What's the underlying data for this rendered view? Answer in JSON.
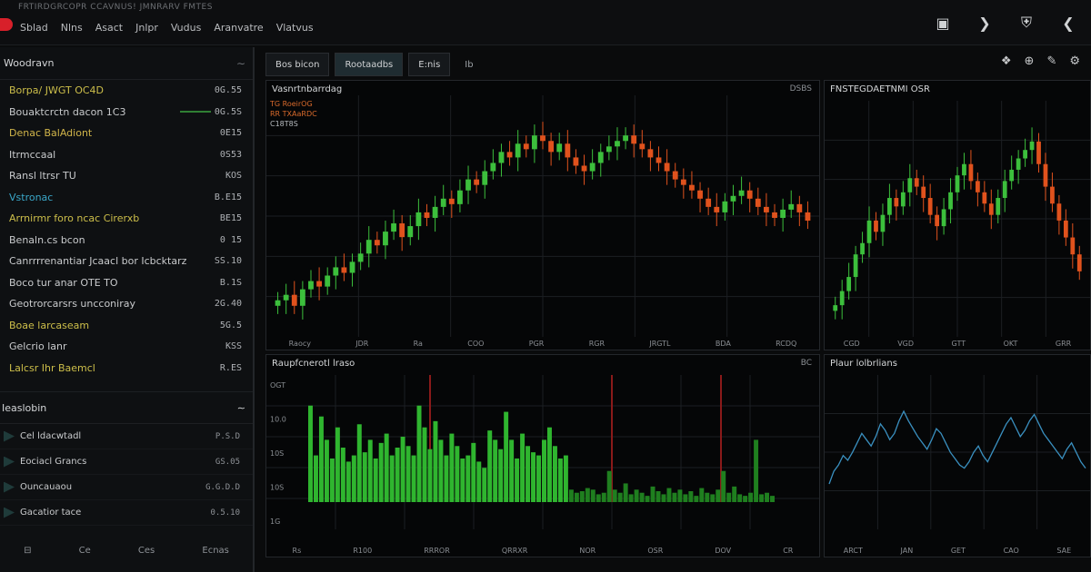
{
  "app": {
    "subtitle": "FRTIRDGRCOPR CCAVNUS! JMNRARV FMTES",
    "nav": [
      "Sblad",
      "Nlns",
      "Asact",
      "Jnlpr",
      "Vudus",
      "Aranvatre",
      "Vlatvus"
    ]
  },
  "top_icons": [
    "bag-icon",
    "bell-icon",
    "cart-icon",
    "share-icon"
  ],
  "sidebar": {
    "watchlist_title": "Woodravn",
    "watchlist": [
      {
        "label": "Borpa/ JWGT OC4D",
        "value": "0G.55",
        "color": "#cdbf4a"
      },
      {
        "label": "Bouaktcrctn dacon 1C3",
        "value": "0G.5S",
        "color": "#c9cbcd"
      },
      {
        "label": "Denac BalAdiont",
        "value": "0E15",
        "color": "#d1b54a"
      },
      {
        "label": "Itrmccaal",
        "value": "0S53",
        "color": "#c9cbcd"
      },
      {
        "label": "Ransl ltrsr TU",
        "value": "KOS",
        "color": "#c9cbcd"
      },
      {
        "label": "Vstronac",
        "value": "B.E15",
        "color": "#3aa7c8"
      },
      {
        "label": "Arrnirmr foro ncac Cirerxb",
        "value": "BE15",
        "color": "#cdbf4a"
      },
      {
        "label": "Benaln.cs bcon",
        "value": "0 15",
        "color": "#c9cbcd"
      },
      {
        "label": "Canrrrrenantiar Jcaacl bor Icbcktarz",
        "value": "SS.10",
        "color": "#c9cbcd"
      },
      {
        "label": "Boco tur anar OTE TO",
        "value": "B.1S",
        "color": "#c9cbcd"
      },
      {
        "label": "Geotrorcarsrs uncconiray",
        "value": "2G.40",
        "color": "#c9cbcd"
      },
      {
        "label": "Boae larcaseam",
        "value": "5G.5",
        "color": "#cdbf4a"
      },
      {
        "label": "Gelcrio lanr",
        "value": "KSS",
        "color": "#c9cbcd"
      },
      {
        "label": "Lalcsr Ihr Baemcl",
        "value": "R.ES",
        "color": "#cdbf4a"
      }
    ],
    "movers_title": "Ieaslobin",
    "movers": [
      {
        "label": "Cel ldacwtadl",
        "value": "P.S.D"
      },
      {
        "label": "Eociacl Grancs",
        "value": "GS.05"
      },
      {
        "label": "Ouncauaou",
        "value": "G.G.D.D"
      },
      {
        "label": "Gacatior tace",
        "value": "0.5.10"
      }
    ],
    "footer": [
      "⊟",
      "Ce",
      "Ces",
      "Ecnas"
    ]
  },
  "tabs": [
    {
      "label": "Bos bicon",
      "active": false
    },
    {
      "label": "Rootaadbs",
      "active": true
    },
    {
      "label": "E:nis",
      "active": false
    }
  ],
  "tab_extra": "Ib",
  "toolbar_icons": [
    "crosshair-icon",
    "zoom-icon",
    "drawing-icon",
    "settings-icon"
  ],
  "panels": {
    "main": {
      "title": "Vasnrtnbarrdag",
      "stats": [
        "TG RoeirOG",
        "RR TXAaRDC",
        "C18T8S"
      ],
      "ctl": "DSBS",
      "x_labels": [
        "Raocy",
        "JDR",
        "Ra",
        "COO",
        "PGR",
        "RGR",
        "JRGTL",
        "BDA",
        "RCDQ"
      ]
    },
    "side": {
      "title": "FNSTEGDAETNMI OSR",
      "x_labels": [
        "CGD",
        "VGD",
        "GTT",
        "OKT",
        "GRR"
      ]
    },
    "volume": {
      "title": "Raupfcnerotl lraso",
      "ctl": "BC",
      "y_labels": [
        "OGT",
        "10.0",
        "10S",
        "10S",
        "1G"
      ],
      "x_labels": [
        "Rs",
        "R100",
        "RRROR",
        "QRRXR",
        "NOR",
        "OSR",
        "DOV",
        "CR"
      ]
    },
    "line": {
      "title": "Plaur lolbrlians",
      "x_labels": [
        "ARCT",
        "JAN",
        "GET",
        "CAO",
        "SAE"
      ]
    }
  },
  "chart_data": [
    {
      "type": "candlestick",
      "title": "Vasnrtnbarrdag",
      "series": [
        {
          "close": [
            38,
            40,
            36,
            42,
            45,
            43,
            47,
            50,
            48,
            52,
            55,
            60,
            58,
            63,
            66,
            61,
            65,
            70,
            68,
            72,
            75,
            73,
            78,
            82,
            80,
            85,
            88,
            92,
            90,
            95,
            93,
            98,
            96,
            92,
            95,
            90,
            87,
            85,
            88,
            92,
            94,
            96,
            98,
            95,
            93,
            90,
            88,
            85,
            82,
            80,
            78,
            75,
            72,
            70,
            74,
            76,
            78,
            75,
            72,
            70,
            68,
            71,
            73,
            70,
            67
          ],
          "up_color": "#3cbf3c",
          "down_color": "#e0521d"
        }
      ]
    },
    {
      "type": "candlestick",
      "title": "FNSTEGDAETNMI OSR",
      "series": [
        {
          "close": [
            40,
            45,
            50,
            58,
            62,
            70,
            66,
            72,
            78,
            75,
            80,
            85,
            82,
            78,
            72,
            68,
            74,
            80,
            86,
            90,
            84,
            80,
            76,
            72,
            78,
            84,
            88,
            92,
            95,
            98,
            90,
            82,
            76,
            70,
            64,
            58,
            52
          ],
          "up_color": "#3cbf3c",
          "down_color": "#e0521d"
        }
      ]
    },
    {
      "type": "bar",
      "title": "Raupfcnerotl lraso",
      "values": [
        62,
        30,
        55,
        40,
        28,
        48,
        35,
        26,
        30,
        50,
        32,
        40,
        28,
        38,
        44,
        30,
        35,
        42,
        36,
        30,
        62,
        48,
        34,
        52,
        40,
        30,
        44,
        36,
        28,
        30,
        38,
        26,
        22,
        46,
        40,
        34,
        58,
        40,
        28,
        44,
        36,
        32,
        30,
        40,
        48,
        36,
        28,
        30,
        8,
        6,
        7,
        9,
        8,
        5,
        6,
        20,
        8,
        6,
        12,
        5,
        8,
        6,
        4,
        10,
        7,
        5,
        9,
        6,
        8,
        5,
        7,
        4,
        9,
        6,
        5,
        8,
        20,
        6,
        10,
        5,
        4,
        6,
        40,
        5,
        6,
        4
      ]
    },
    {
      "type": "line",
      "title": "Plaur lolbrlians",
      "values": [
        20,
        28,
        32,
        38,
        35,
        40,
        46,
        52,
        48,
        44,
        50,
        58,
        54,
        48,
        52,
        60,
        66,
        60,
        55,
        50,
        46,
        42,
        48,
        55,
        52,
        46,
        40,
        36,
        32,
        30,
        34,
        40,
        44,
        38,
        34,
        40,
        46,
        52,
        58,
        62,
        56,
        50,
        54,
        60,
        64,
        58,
        52,
        48,
        44,
        40,
        36,
        42,
        46,
        40,
        34,
        30
      ]
    }
  ]
}
